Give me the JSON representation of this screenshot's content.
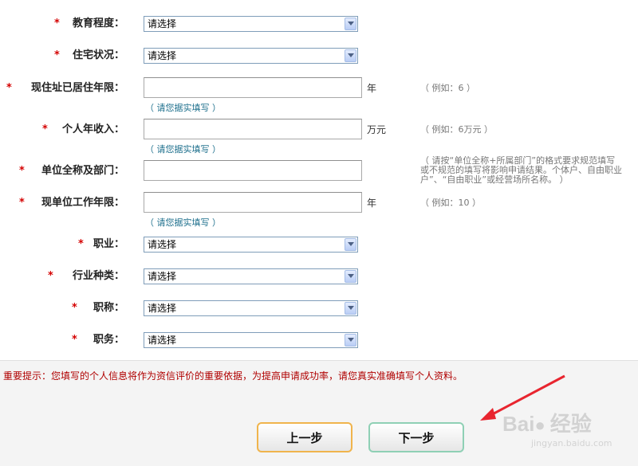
{
  "star": "*",
  "fields": {
    "education": {
      "label": "教育程度：",
      "value": "请选择"
    },
    "housing": {
      "label": "住宅状况：",
      "value": "请选择"
    },
    "years_at_address": {
      "label": "现住址已居住年限：",
      "unit": "年",
      "example": "（ 例如：6 ）",
      "hint": "（ 请您据实填写 ）"
    },
    "income": {
      "label": "个人年收入：",
      "unit": "万元",
      "example": "（ 例如：6万元 ）",
      "hint": "（ 请您据实填写 ）"
    },
    "employer": {
      "label": "单位全称及部门：",
      "note": [
        "（ 请按“单位全称+所属部门”的格式要求规范填写",
        "或不规范的填写将影响申请结果。个体户、自由职业",
        "户”、“自由职业”或经营场所名称。 ）"
      ]
    },
    "years_at_job": {
      "label": "现单位工作年限：",
      "unit": "年",
      "example": "（ 例如：10 ）",
      "hint": "（ 请您据实填写 ）"
    },
    "occupation": {
      "label": "职业：",
      "value": "请选择"
    },
    "industry": {
      "label": "行业种类：",
      "value": "请选择"
    },
    "title": {
      "label": "职称：",
      "value": "请选择"
    },
    "position": {
      "label": "职务：",
      "value": "请选择"
    }
  },
  "notice": "重要提示：您填写的个人信息将作为资信评价的重要依据，为提高申请成功率，请您真实准确填写个人资料。",
  "buttons": {
    "prev": "上一步",
    "next": "下一步"
  },
  "watermark": {
    "brand": "Bai",
    "brand2": "经验",
    "url": "jingyan.baidu.com"
  },
  "colors": {
    "required_star": "#d40000",
    "notice_text": "#b00000",
    "hint_text": "#1d6f8c",
    "arrow": "#e8252f",
    "prev_border": "#f0b44c",
    "next_border": "#8fd0b5"
  }
}
